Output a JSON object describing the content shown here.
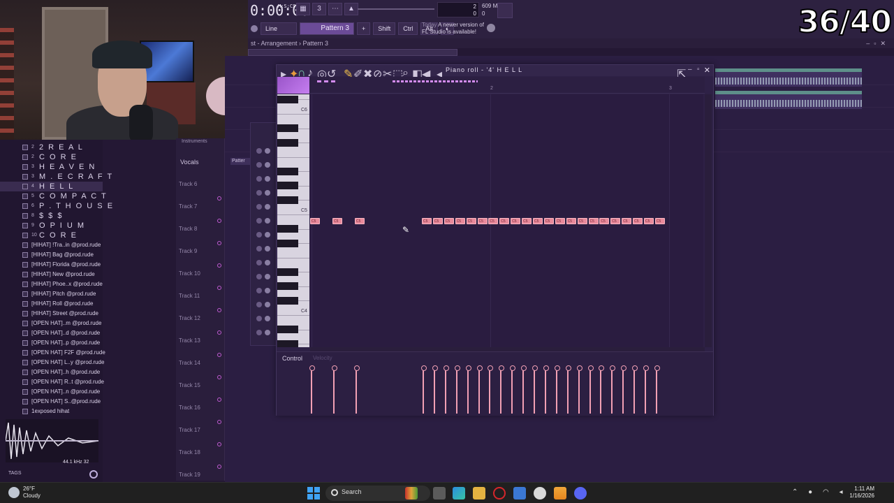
{
  "score": "36/40",
  "transport": {
    "time": "0:00:00",
    "time_unit": "M:S:CS",
    "tempo_bars": "2",
    "tempo_zero": "0"
  },
  "memory": {
    "value": "609 MB",
    "cpu": "0"
  },
  "toolbar": {
    "snap": "Line",
    "pattern": "Pattern 3",
    "shift": "Shift",
    "ctrl": "Ctrl",
    "alt": "Alt",
    "news_day": "Today",
    "news_text": "A newer version of",
    "news_text2": "FL Studio is available!"
  },
  "arrangement": {
    "breadcrumb": "st - Arrangement",
    "pattern": "Pattern 3"
  },
  "browser": {
    "items": [
      {
        "num": "2",
        "label": "2 R E A L"
      },
      {
        "num": "2",
        "label": "C O R E"
      },
      {
        "num": "3",
        "label": "H E A V E N"
      },
      {
        "num": "3",
        "label": "M . E C R A F T"
      },
      {
        "num": "4",
        "label": "H E L L"
      },
      {
        "num": "5",
        "label": "C O M P A C T"
      },
      {
        "num": "6",
        "label": "P . T H O U S E"
      },
      {
        "num": "8",
        "label": "$ $ $"
      },
      {
        "num": "9",
        "label": "O P I U M"
      },
      {
        "num": "10",
        "label": "C O R E"
      }
    ],
    "files": [
      "[HIHAT] !Tra..in @prod.rude",
      "[HIHAT] Bag @prod.rude",
      "[HIHAT] Florida @prod.rude",
      "[HIHAT] New @prod.rude",
      "[HIHAT] Phoe..x @prod.rude",
      "[HIHAT] Pitch @prod.rude",
      "[HIHAT] Roll @prod.rude",
      "[HIHAT] Street @prod.rude",
      "[OPEN HAT]..m @prod.rude",
      "[OPEN HAT]..d @prod.rude",
      "[OPEN HAT]..p @prod.rude",
      "[OPEN HAT] F2F @prod.rude",
      "[OPEN HAT] L..y @prod.rude",
      "[OPEN HAT]..h @prod.rude",
      "[OPEN HAT] R..t @prod.rude",
      "[OPEN HAT]..n @prod.rude",
      "[OPEN HAT] S..@prod.rude",
      "1exposed hihat"
    ],
    "sample_info": "44.1 kHz 32",
    "tags": "TAGS"
  },
  "tracks": {
    "header": "Instruments",
    "vocals": "Vocals",
    "pattern_label": "Patter",
    "names": [
      "Track 6",
      "Track 7",
      "Track 8",
      "Track 9",
      "Track 10",
      "Track 11",
      "Track 12",
      "Track 13",
      "Track 14",
      "Track 15",
      "Track 16",
      "Track 17",
      "Track 18",
      "Track 19"
    ]
  },
  "piano_roll": {
    "title": "Piano roll - '4' H E L L",
    "ruler": [
      "2",
      "3"
    ],
    "key_labels": [
      "C6",
      "C5",
      "C4"
    ],
    "control_label": "Control",
    "control_sub": "Velocity",
    "note_label": "C5"
  },
  "taskbar": {
    "temp": "26°F",
    "condition": "Cloudy",
    "search": "Search",
    "time": "1:11 AM",
    "date": "1/16/2026"
  }
}
